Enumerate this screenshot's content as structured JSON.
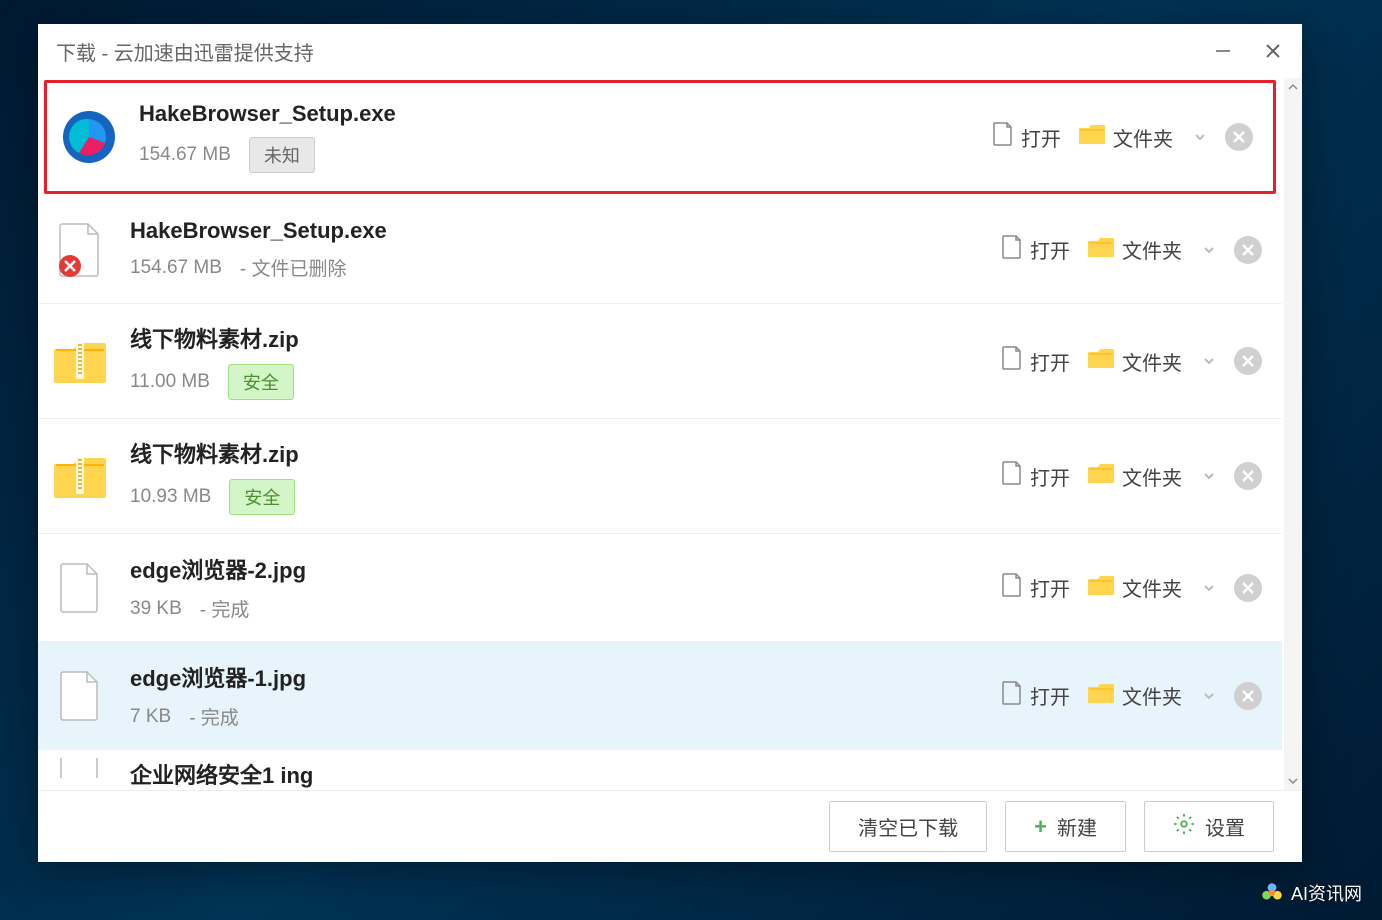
{
  "window": {
    "title": "下载 - 云加速由迅雷提供支持"
  },
  "downloads": [
    {
      "icon": "app-logo",
      "name": "HakeBrowser_Setup.exe",
      "size": "154.67 MB",
      "badge": {
        "type": "unknown",
        "text": "未知"
      },
      "status": "",
      "highlighted": true,
      "hovered": false
    },
    {
      "icon": "file-error",
      "name": "HakeBrowser_Setup.exe",
      "size": "154.67 MB",
      "badge": null,
      "status": "- 文件已删除",
      "highlighted": false,
      "hovered": false
    },
    {
      "icon": "zip",
      "name": "线下物料素材.zip",
      "size": "11.00 MB",
      "badge": {
        "type": "safe",
        "text": "安全"
      },
      "status": "",
      "highlighted": false,
      "hovered": false
    },
    {
      "icon": "zip",
      "name": "线下物料素材.zip",
      "size": "10.93 MB",
      "badge": {
        "type": "safe",
        "text": "安全"
      },
      "status": "",
      "highlighted": false,
      "hovered": false
    },
    {
      "icon": "file",
      "name": "edge浏览器-2.jpg",
      "size": "39 KB",
      "badge": null,
      "status": "- 完成",
      "highlighted": false,
      "hovered": false
    },
    {
      "icon": "file",
      "name": "edge浏览器-1.jpg",
      "size": "7 KB",
      "badge": null,
      "status": "- 完成",
      "highlighted": false,
      "hovered": true
    }
  ],
  "partial": {
    "name": "企业网络安全1 ing"
  },
  "actions": {
    "open": "打开",
    "folder": "文件夹"
  },
  "footer": {
    "clear": "清空已下载",
    "new": "新建",
    "settings": "设置"
  },
  "watermark": "AI资讯网"
}
